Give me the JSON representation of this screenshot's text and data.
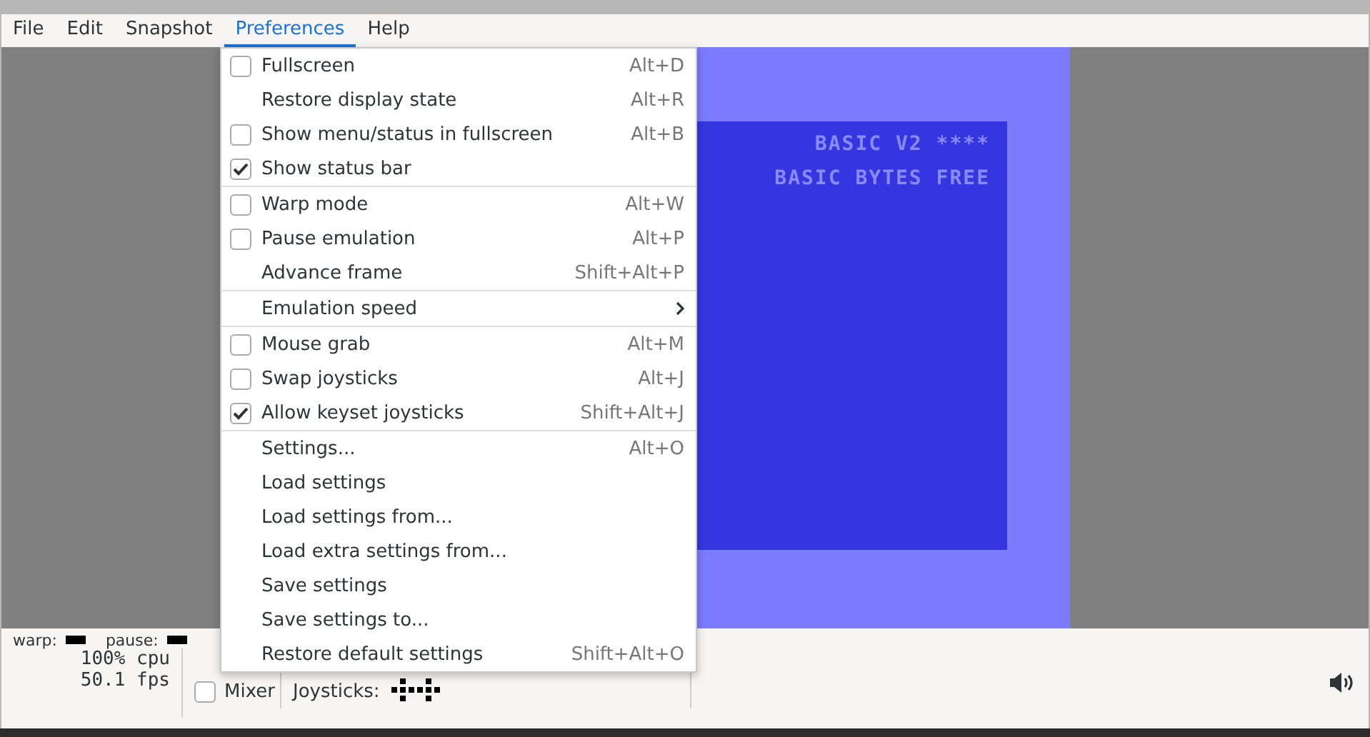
{
  "menubar": [
    {
      "label": "File",
      "selected": false
    },
    {
      "label": "Edit",
      "selected": false
    },
    {
      "label": "Snapshot",
      "selected": false
    },
    {
      "label": "Preferences",
      "selected": true
    },
    {
      "label": "Help",
      "selected": false
    }
  ],
  "screen": {
    "lines": [
      "BASIC V2 ****",
      "BASIC BYTES FREE"
    ]
  },
  "menu": {
    "sections": [
      [
        {
          "kind": "check",
          "label": "Fullscreen",
          "shortcut": "Alt+D",
          "checked": false
        },
        {
          "kind": "plain",
          "label": "Restore display state",
          "shortcut": "Alt+R"
        },
        {
          "kind": "check",
          "label": "Show menu/status in fullscreen",
          "shortcut": "Alt+B",
          "checked": false
        },
        {
          "kind": "check",
          "label": "Show status bar",
          "checked": true
        }
      ],
      [
        {
          "kind": "check",
          "label": "Warp mode",
          "shortcut": "Alt+W",
          "checked": false
        },
        {
          "kind": "check",
          "label": "Pause emulation",
          "shortcut": "Alt+P",
          "checked": false
        },
        {
          "kind": "plain",
          "label": "Advance frame",
          "shortcut": "Shift+Alt+P"
        }
      ],
      [
        {
          "kind": "submenu",
          "label": "Emulation speed"
        }
      ],
      [
        {
          "kind": "check",
          "label": "Mouse grab",
          "shortcut": "Alt+M",
          "checked": false
        },
        {
          "kind": "check",
          "label": "Swap joysticks",
          "shortcut": "Alt+J",
          "checked": false
        },
        {
          "kind": "check",
          "label": "Allow keyset joysticks",
          "shortcut": "Shift+Alt+J",
          "checked": true
        }
      ],
      [
        {
          "kind": "plain",
          "label": "Settings...",
          "shortcut": "Alt+O"
        },
        {
          "kind": "plain",
          "label": "Load settings"
        },
        {
          "kind": "plain",
          "label": "Load settings from..."
        },
        {
          "kind": "plain",
          "label": "Load extra settings from..."
        },
        {
          "kind": "plain",
          "label": "Save settings"
        },
        {
          "kind": "plain",
          "label": "Save settings to..."
        },
        {
          "kind": "plain",
          "label": "Restore default settings",
          "shortcut": "Shift+Alt+O"
        }
      ]
    ]
  },
  "status_bar": {
    "warp_label": "warp:",
    "pause_label": "pause:",
    "cpu": "100% cpu",
    "fps": "50.1 fps",
    "mixer": {
      "label": "Mixer",
      "checked": false
    },
    "joysticks_label": "Joysticks:"
  }
}
